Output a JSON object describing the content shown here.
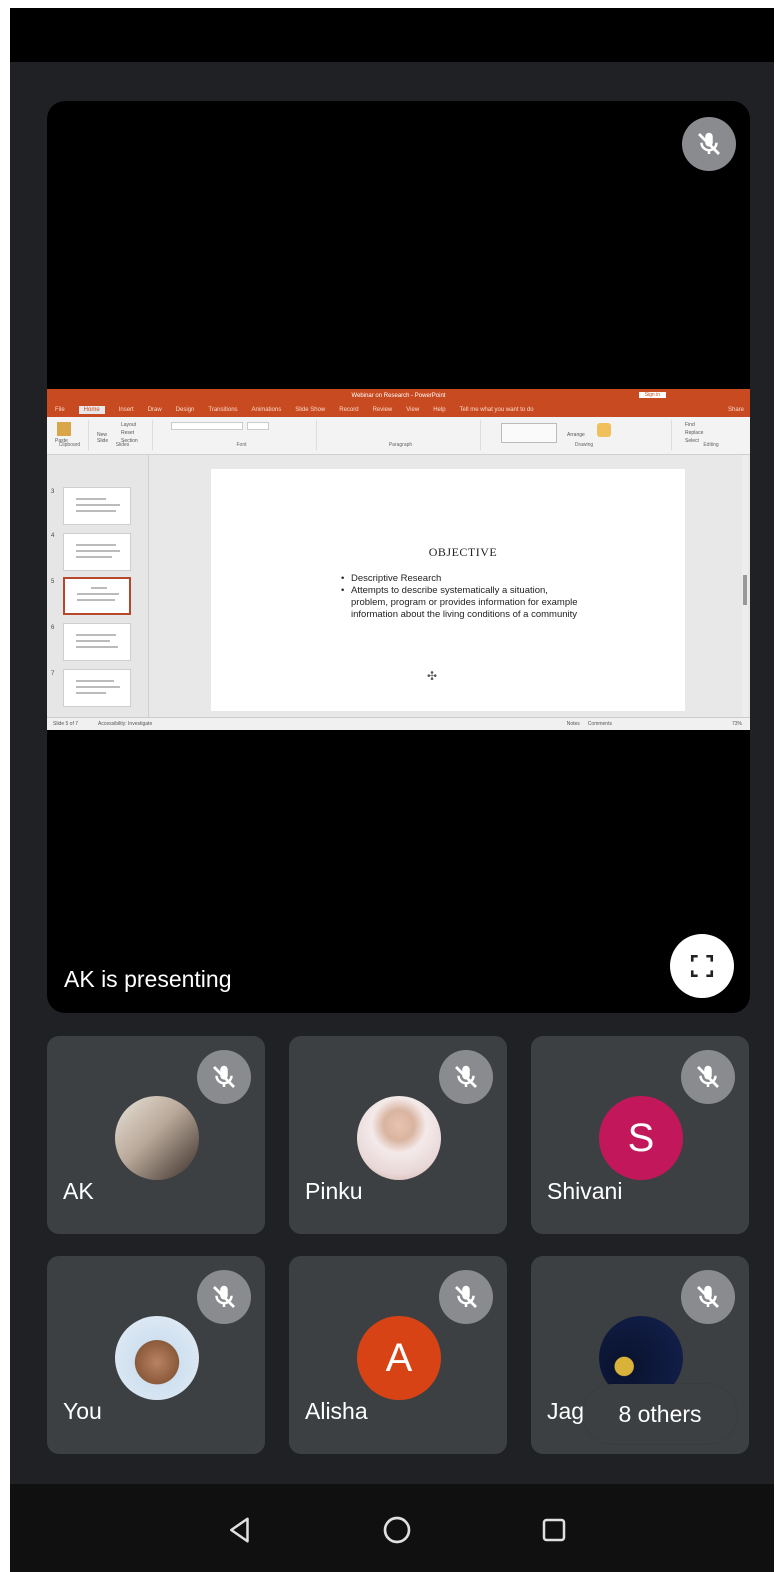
{
  "presenter": {
    "label": "AK is presenting",
    "muted": true
  },
  "powerpoint": {
    "title_bar": "Webinar on Research - PowerPoint",
    "sign_in": "Sign in",
    "tabs": [
      "File",
      "Home",
      "Insert",
      "Draw",
      "Design",
      "Transitions",
      "Animations",
      "Slide Show",
      "Record",
      "Review",
      "View",
      "Help"
    ],
    "active_tab": "Home",
    "tell_me": "Tell me what you want to do",
    "share": "Share",
    "ribbon_groups": [
      "Clipboard",
      "Slides",
      "Font",
      "Paragraph",
      "Drawing",
      "Editing"
    ],
    "ribbon_items": {
      "paste": "Paste",
      "new_slide": "New Slide",
      "layout": "Layout",
      "reset": "Reset",
      "section": "Section",
      "arrange": "Arrange",
      "find": "Find",
      "replace": "Replace",
      "select": "Select"
    },
    "thumbnail_numbers": [
      "3",
      "4",
      "5",
      "6",
      "7"
    ],
    "selected_thumbnail": "5",
    "slide": {
      "heading": "OBJECTIVE",
      "bullets": [
        "Descriptive Research",
        "Attempts to describe systematically a situation, problem, program or provides information for example information about the living conditions of a community"
      ]
    },
    "status": {
      "slide_info": "Slide 5 of 7",
      "accessibility": "Accessibility: Investigate",
      "notes": "Notes",
      "comments": "Comments",
      "zoom": "73%"
    }
  },
  "participants": [
    {
      "name": "AK",
      "avatar_type": "photo",
      "avatar_colors": [
        "#e8e2d8",
        "#3a2e28"
      ],
      "muted": true
    },
    {
      "name": "Pinku",
      "avatar_type": "photo",
      "avatar_colors": [
        "#f4eaea",
        "#caa79a"
      ],
      "muted": true
    },
    {
      "name": "Shivani",
      "avatar_type": "initial",
      "initial": "S",
      "color": "#c2185b",
      "muted": true
    },
    {
      "name": "You",
      "avatar_type": "photo",
      "avatar_colors": [
        "#cfe0f0",
        "#8a5a3a"
      ],
      "muted": true
    },
    {
      "name": "Alisha",
      "avatar_type": "initial",
      "initial": "A",
      "color": "#d84315",
      "muted": true
    },
    {
      "name": "Jag",
      "avatar_type": "photo",
      "avatar_colors": [
        "#0a1330",
        "#d9b23a"
      ],
      "muted": true
    }
  ],
  "others_label": "8 others",
  "nav": [
    "back-icon",
    "home-icon",
    "recents-icon"
  ]
}
